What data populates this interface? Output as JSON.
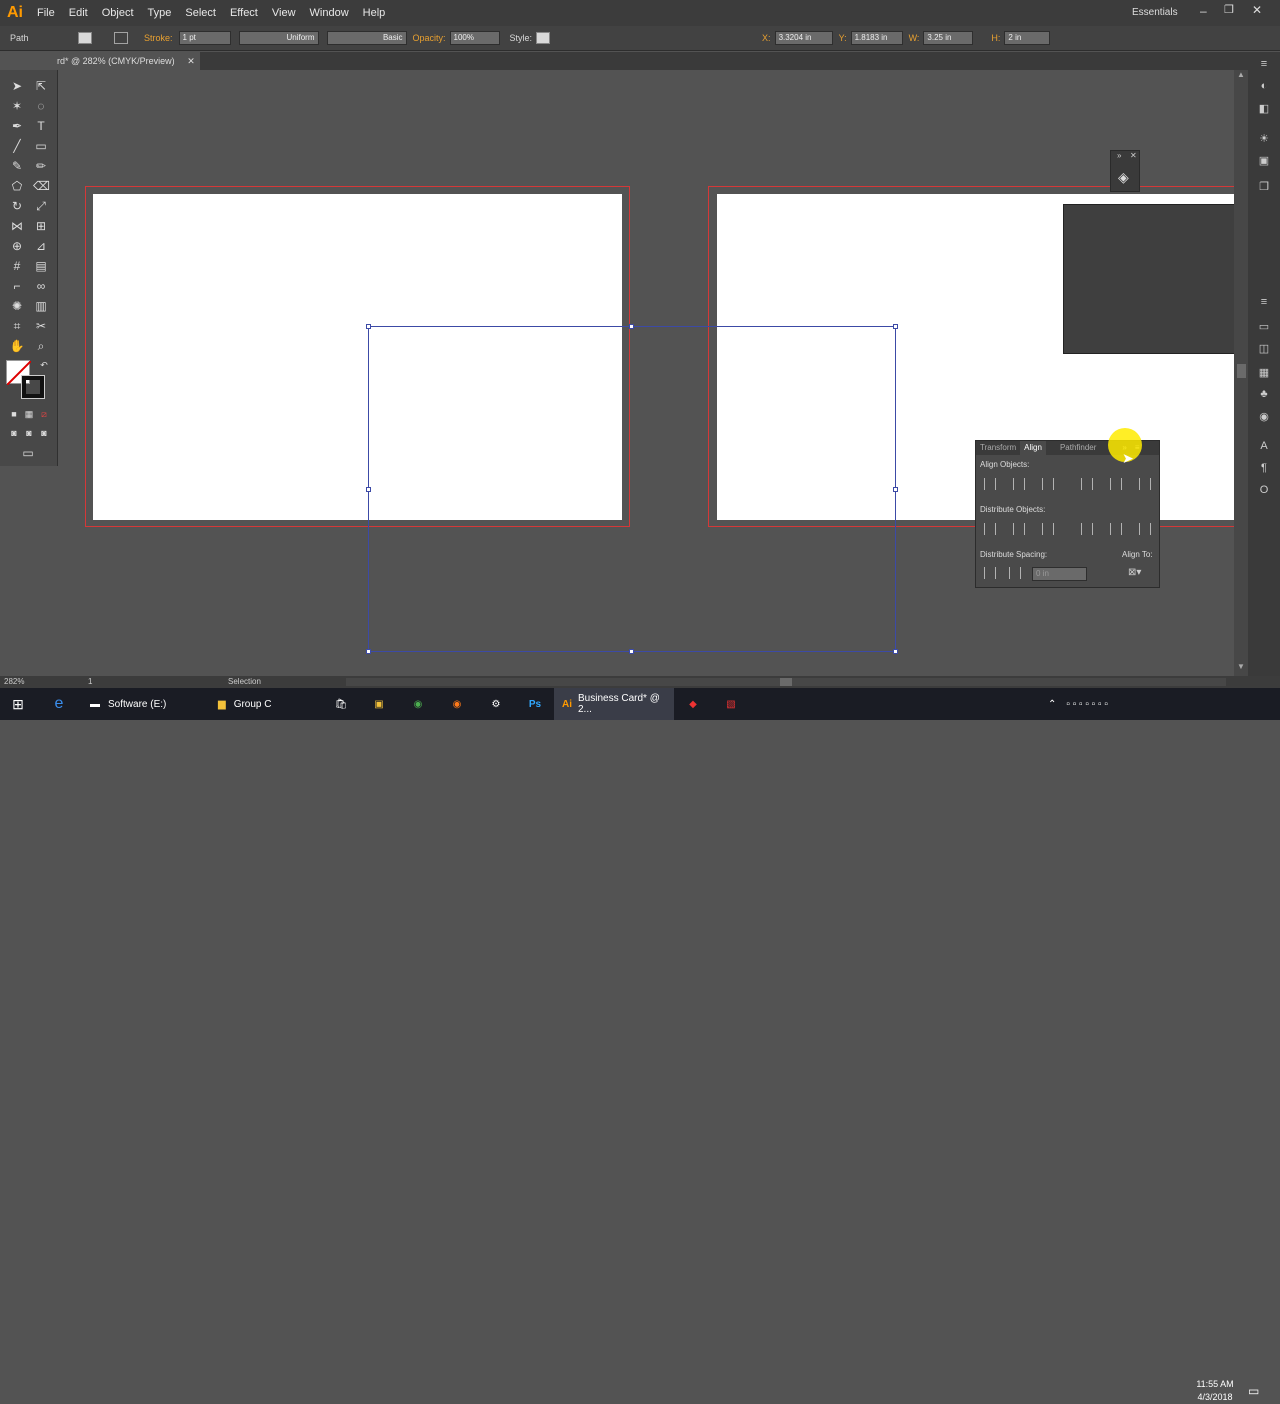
{
  "app": {
    "logo": "Ai",
    "menu": [
      "File",
      "Edit",
      "Object",
      "Type",
      "Select",
      "Effect",
      "View",
      "Window",
      "Help"
    ],
    "workspace": "Essentials"
  },
  "control": {
    "object_type": "Path",
    "stroke_label": "Stroke:",
    "stroke_weight": "1 pt",
    "profile": "Uniform",
    "brush": "Basic",
    "opacity_label": "Opacity:",
    "opacity": "100%",
    "style_label": "Style:",
    "x_label": "X:",
    "x": "3.3204 in",
    "y_label": "Y:",
    "y": "1.8183 in",
    "w_label": "W:",
    "w": "3.25 in",
    "h_label": "H:",
    "h": "2 in"
  },
  "document": {
    "tab_title": "rd* @ 282% (CMYK/Preview)"
  },
  "align_panel": {
    "tabs": [
      "Transform",
      "Align",
      "Pathfinder"
    ],
    "align_objects": "Align Objects:",
    "distribute_objects": "Distribute Objects:",
    "distribute_spacing": "Distribute Spacing:",
    "align_to": "Align To:",
    "spacing_value": "0 in"
  },
  "status": {
    "zoom": "282%",
    "page": "1",
    "tool": "Selection"
  },
  "taskbar": {
    "items": [
      "Software (E:)",
      "Group C",
      "Business Card* @ 2..."
    ],
    "time": "11:55 AM",
    "date": "4/3/2018"
  },
  "colors": {
    "accent": "#ff9a00",
    "bleed": "#d43838",
    "selection": "#3c4aa6"
  }
}
